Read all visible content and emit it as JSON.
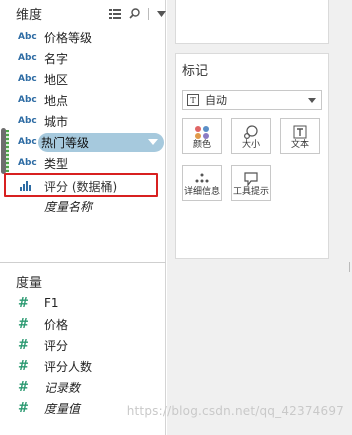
{
  "dimensions": {
    "title": "维度",
    "items": [
      {
        "type": "Abc",
        "label": "价格等级"
      },
      {
        "type": "Abc",
        "label": "名字"
      },
      {
        "type": "Abc",
        "label": "地区"
      },
      {
        "type": "Abc",
        "label": "地点"
      },
      {
        "type": "Abc",
        "label": "城市"
      },
      {
        "type": "Abc",
        "label": "热门等级"
      },
      {
        "type": "Abc",
        "label": "类型"
      },
      {
        "type": "bins",
        "label": "评分 (数据桶)"
      },
      {
        "type": "none",
        "label": "度量名称"
      }
    ]
  },
  "measures": {
    "title": "度量",
    "items": [
      {
        "label": "F1"
      },
      {
        "label": "价格"
      },
      {
        "label": "评分"
      },
      {
        "label": "评分人数"
      },
      {
        "label": "记录数"
      },
      {
        "label": "度量值"
      }
    ],
    "symbol": "#"
  },
  "marks": {
    "title": "标记",
    "type_value": "自动",
    "type_icon": "T",
    "buttons": [
      {
        "label": "颜色",
        "icon": "color-icon"
      },
      {
        "label": "大小",
        "icon": "size-icon"
      },
      {
        "label": "文本",
        "icon": "text-icon"
      },
      {
        "label": "详细信息",
        "icon": "detail-icon"
      },
      {
        "label": "工具提示",
        "icon": "tooltip-icon"
      }
    ]
  },
  "watermark": "https://blog.csdn.net/qq_42374697",
  "colors": {
    "accent_pill": "#a6c9dd",
    "highlight_box": "#d82020",
    "dimension_icon": "#2e6ca4",
    "measure_icon": "#2c9a72"
  }
}
